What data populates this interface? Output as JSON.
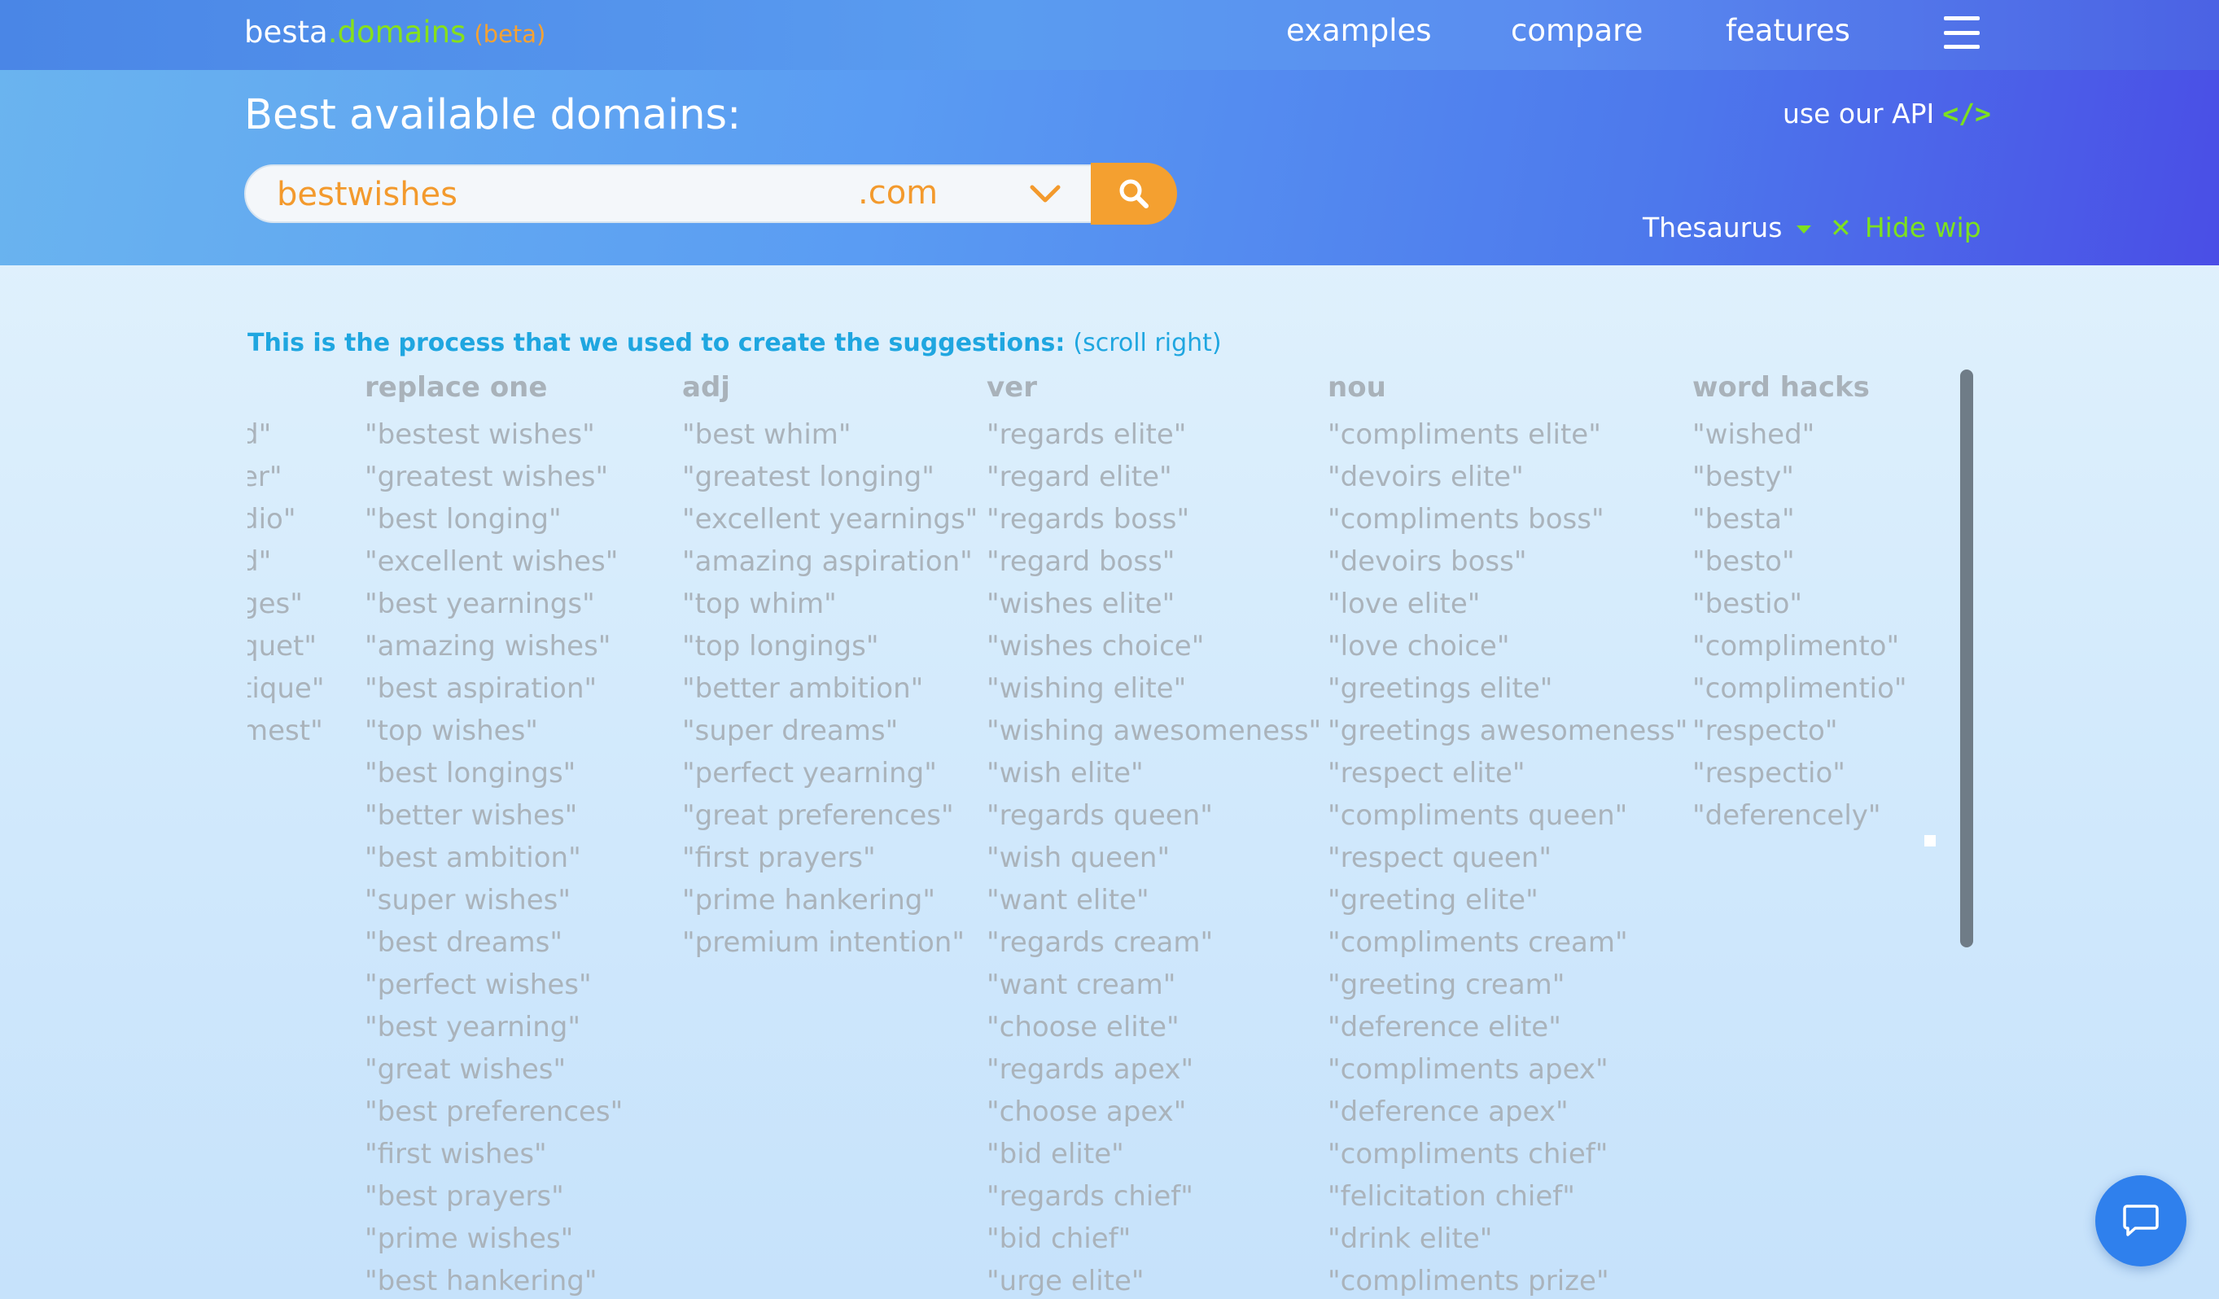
{
  "header": {
    "logo": {
      "brand": "besta",
      "dot": ".",
      "domains": "domains",
      "beta": "(beta)"
    },
    "nav": [
      "examples",
      "compare",
      "features"
    ],
    "menu_icon": "hamburger-menu-icon",
    "title": "Best available domains:",
    "api_link": "use our API",
    "api_icon": "code-icon",
    "search": {
      "value": "bestwishes",
      "tld": ".com"
    },
    "thesaurus": "Thesaurus",
    "hide_wip": "Hide wip",
    "hide_icon": "close-icon"
  },
  "colors": {
    "accent_green": "#7de01f",
    "accent_orange": "#f4a030",
    "title_blue": "#1fa6e0",
    "chat_blue": "#2f80ed"
  },
  "process": {
    "title": "This is the process that we used to create the suggestions:",
    "scroll_hint": "(scroll right)",
    "partial_column": {
      "items": [
        "d\"",
        "er\"",
        "dio\"",
        "d\"",
        "ges\"",
        "quet\"",
        "tique\"",
        "mest\""
      ]
    },
    "columns": [
      {
        "heading": "replace one",
        "items": [
          "\"bestest wishes\"",
          "\"greatest wishes\"",
          "\"best longing\"",
          "\"excellent wishes\"",
          "\"best yearnings\"",
          "\"amazing wishes\"",
          "\"best aspiration\"",
          "\"top wishes\"",
          "\"best longings\"",
          "\"better wishes\"",
          "\"best ambition\"",
          "\"super wishes\"",
          "\"best dreams\"",
          "\"perfect wishes\"",
          "\"best yearning\"",
          "\"great wishes\"",
          "\"best preferences\"",
          "\"first wishes\"",
          "\"best prayers\"",
          "\"prime wishes\"",
          "\"best hankering\""
        ]
      },
      {
        "heading": "adj",
        "items": [
          "\"best whim\"",
          "\"greatest longing\"",
          "\"excellent yearnings\"",
          "\"amazing aspiration\"",
          "\"top whim\"",
          "\"top longings\"",
          "\"better ambition\"",
          "\"super dreams\"",
          "\"perfect yearning\"",
          "\"great preferences\"",
          "\"first prayers\"",
          "\"prime hankering\"",
          "\"premium intention\""
        ]
      },
      {
        "heading": "ver",
        "items": [
          "\"regards elite\"",
          "\"regard elite\"",
          "\"regards boss\"",
          "\"regard boss\"",
          "\"wishes elite\"",
          "\"wishes choice\"",
          "\"wishing elite\"",
          "\"wishing awesomeness\"",
          "\"wish elite\"",
          "\"regards queen\"",
          "\"wish queen\"",
          "\"want elite\"",
          "\"regards cream\"",
          "\"want cream\"",
          "\"choose elite\"",
          "\"regards apex\"",
          "\"choose apex\"",
          "\"bid elite\"",
          "\"regards chief\"",
          "\"bid chief\"",
          "\"urge elite\""
        ]
      },
      {
        "heading": "nou",
        "items": [
          "\"compliments elite\"",
          "\"devoirs elite\"",
          "\"compliments boss\"",
          "\"devoirs boss\"",
          "\"love elite\"",
          "\"love choice\"",
          "\"greetings elite\"",
          "\"greetings awesomeness\"",
          "\"respect elite\"",
          "\"compliments queen\"",
          "\"respect queen\"",
          "\"greeting elite\"",
          "\"compliments cream\"",
          "\"greeting cream\"",
          "\"deference elite\"",
          "\"compliments apex\"",
          "\"deference apex\"",
          "\"compliments chief\"",
          "\"felicitation chief\"",
          "\"drink elite\"",
          "\"compliments prize\""
        ]
      },
      {
        "heading": "word hacks",
        "items": [
          "\"wished\"",
          "\"besty\"",
          "\"besta\"",
          "\"besto\"",
          "\"bestio\"",
          "\"complimento\"",
          "\"complimentio\"",
          "\"respecto\"",
          "\"respectio\"",
          "\"deferencely\""
        ]
      }
    ]
  },
  "chat": {
    "icon": "chat-bubble-icon"
  }
}
